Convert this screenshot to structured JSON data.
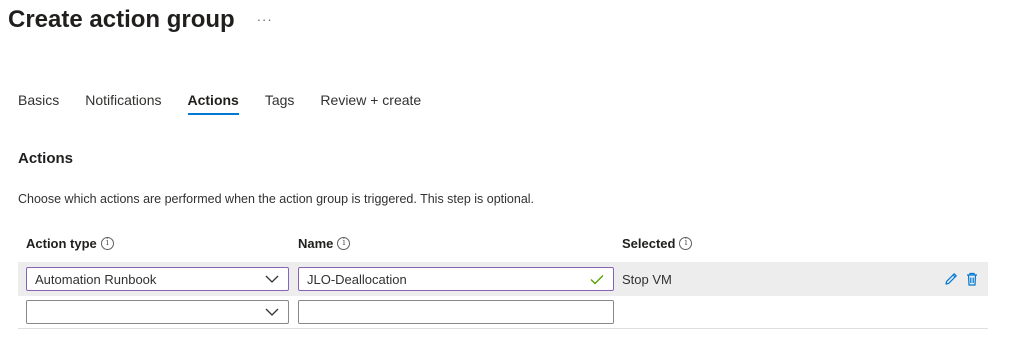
{
  "header": {
    "title": "Create action group",
    "more_label": "···"
  },
  "tabs": [
    {
      "label": "Basics",
      "active": false
    },
    {
      "label": "Notifications",
      "active": false
    },
    {
      "label": "Actions",
      "active": true
    },
    {
      "label": "Tags",
      "active": false
    },
    {
      "label": "Review + create",
      "active": false
    }
  ],
  "section": {
    "heading": "Actions",
    "description": "Choose which actions are performed when the action group is triggered. This step is optional."
  },
  "table": {
    "columns": [
      {
        "label": "Action type"
      },
      {
        "label": "Name"
      },
      {
        "label": "Selected"
      }
    ],
    "rows": [
      {
        "action_type": "Automation Runbook",
        "name": "JLO-Deallocation",
        "selected": "Stop VM"
      },
      {
        "action_type": "",
        "name": "",
        "selected": ""
      }
    ]
  },
  "icons": {
    "info": "info-icon",
    "chevron": "chevron-down-icon",
    "valid": "checkmark-icon",
    "edit": "pencil-icon",
    "delete": "trash-icon"
  },
  "colors": {
    "accent": "#0078d4",
    "focus_border": "#8764b8",
    "valid_check": "#57a300",
    "row_highlight": "#ededed"
  }
}
